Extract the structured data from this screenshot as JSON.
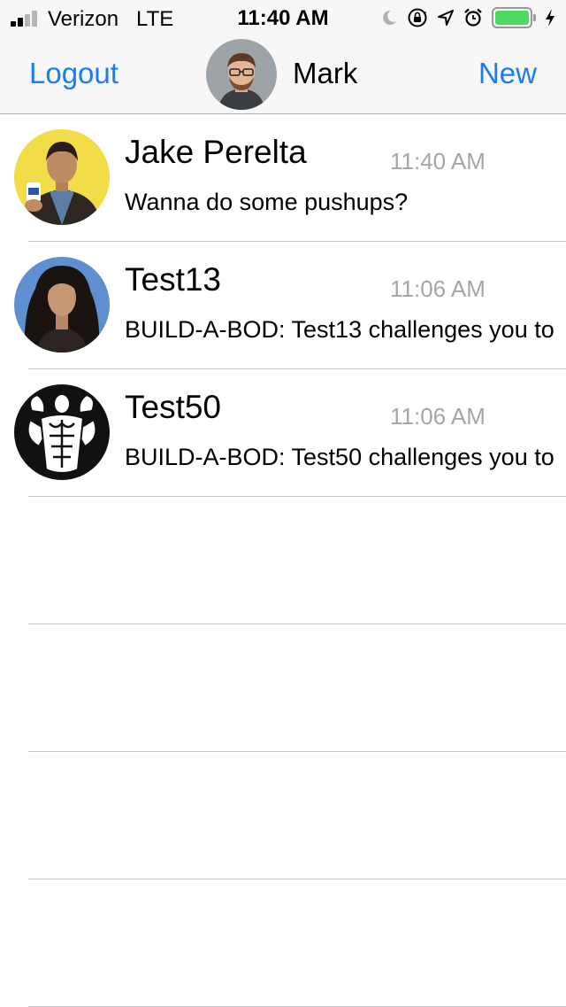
{
  "status_bar": {
    "carrier": "Verizon",
    "network": "LTE",
    "time": "11:40 AM",
    "icons": [
      "moon-icon",
      "orientation-lock-icon",
      "location-icon",
      "alarm-icon",
      "battery-icon",
      "charging-icon"
    ],
    "battery_color": "#4cd964"
  },
  "nav": {
    "left_label": "Logout",
    "title": "Mark",
    "right_label": "New",
    "accent": "#1a7cf6"
  },
  "conversations": [
    {
      "name": "Jake Perelta",
      "time": "11:40 AM",
      "preview": "Wanna do some pushups?"
    },
    {
      "name": "Test13",
      "time": "11:06 AM",
      "preview": "BUILD-A-BOD: Test13 challenges you to"
    },
    {
      "name": "Test50",
      "time": "11:06 AM",
      "preview": "BUILD-A-BOD: Test50 challenges you to"
    }
  ]
}
